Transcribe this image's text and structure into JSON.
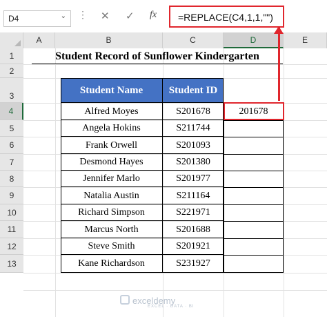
{
  "formula_bar": {
    "name_box": "D4",
    "cancel_icon": "✕",
    "enter_icon": "✓",
    "fx_label": "fx",
    "formula": "=REPLACE(C4,1,1,\"\")"
  },
  "columns": [
    "A",
    "B",
    "C",
    "D",
    "E"
  ],
  "rows": [
    "1",
    "2",
    "3",
    "4",
    "5",
    "6",
    "7",
    "8",
    "9",
    "10",
    "11",
    "12",
    "13"
  ],
  "sheet": {
    "title": "Student Record of Sunflower Kindergarten",
    "headers": {
      "name": "Student Name",
      "id": "Student ID"
    },
    "records": [
      {
        "name": "Alfred Moyes",
        "id": "S201678"
      },
      {
        "name": "Angela Hokins",
        "id": "S211744"
      },
      {
        "name": "Frank Orwell",
        "id": "S201093"
      },
      {
        "name": "Desmond Hayes",
        "id": "S201380"
      },
      {
        "name": "Jennifer Marlo",
        "id": "S201977"
      },
      {
        "name": "Natalia Austin",
        "id": "S211164"
      },
      {
        "name": "Richard Simpson",
        "id": "S221971"
      },
      {
        "name": "Marcus North",
        "id": "S201688"
      },
      {
        "name": "Steve Smith",
        "id": "S201921"
      },
      {
        "name": "Kane Richardson",
        "id": "S231927"
      }
    ],
    "d4_value": "201678"
  },
  "watermark": {
    "text": "exceldemy",
    "tagline": "EXCEL · DATA · BI"
  },
  "colors": {
    "header_fill": "#4472c4",
    "highlight": "#e0262d",
    "excel_green": "#1f6a3a"
  }
}
